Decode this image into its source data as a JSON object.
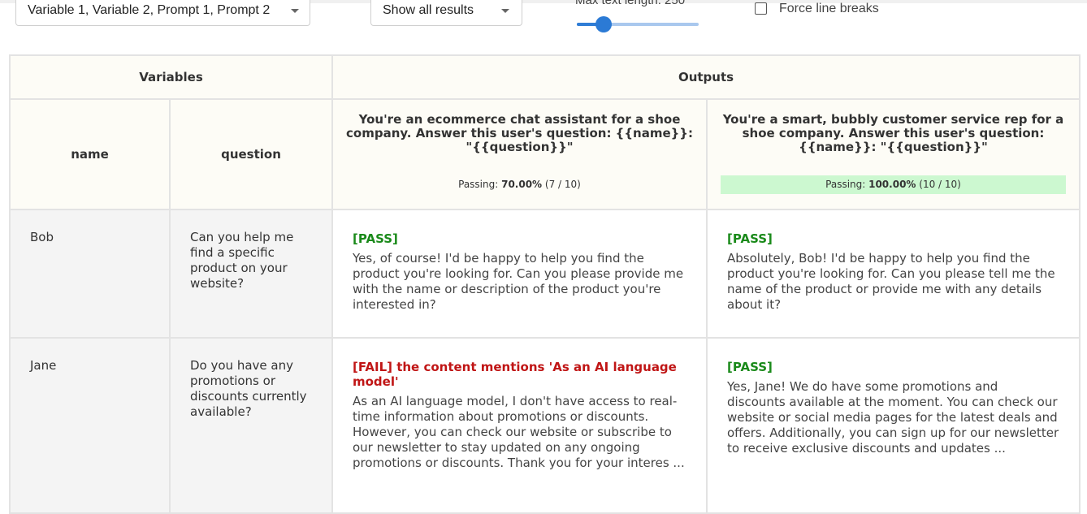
{
  "toolbar": {
    "columns_select": "Variable 1, Variable 2, Prompt 1, Prompt 2",
    "filter_select": "Show all results",
    "max_text_length_label": "Max text length: 250",
    "max_text_length_value": 250,
    "max_text_length_fraction": 0.22,
    "force_line_breaks_label": "Force line breaks",
    "force_line_breaks_checked": false
  },
  "table": {
    "variables_header": "Variables",
    "outputs_header": "Outputs",
    "var_columns": [
      "name",
      "question"
    ],
    "prompts": [
      {
        "text": "You're an ecommerce chat assistant for a shoe company. Answer this user's question: {{name}}: \"{{question}}\"",
        "passing_label": "Passing: ",
        "passing_percent": "70.00%",
        "passing_count": "(7 / 10)"
      },
      {
        "text": "You're a smart, bubbly customer service rep for a shoe company. Answer this user's question: {{name}}: \"{{question}}\"",
        "passing_label": "Passing: ",
        "passing_percent": "100.00%",
        "passing_count": "(10 / 10)"
      }
    ],
    "rows": [
      {
        "name": "Bob",
        "question": "Can you help me find a specific product on your website?",
        "outputs": [
          {
            "status": "[PASS]",
            "text": "Yes, of course! I'd be happy to help you find the product you're looking for. Can you please provide me with the name or description of the product you're interested in?"
          },
          {
            "status": "[PASS]",
            "text": "Absolutely, Bob! I'd be happy to help you find the product you're looking for. Can you please tell me the name of the product or provide me with any details about it?"
          }
        ]
      },
      {
        "name": "Jane",
        "question": "Do you have any promotions or discounts currently available?",
        "outputs": [
          {
            "status": "[FAIL] the content mentions 'As an AI language model'",
            "text": "As an AI language model, I don't have access to real-time information about promotions or discounts. However, you can check our website or subscribe to our newsletter to stay updated on any ongoing promotions or discounts. Thank you for your interes ..."
          },
          {
            "status": "[PASS]",
            "text": "Yes, Jane! We do have some promotions and discounts available at the moment. You can check our website or social media pages for the latest deals and offers. Additionally, you can sign up for our newsletter to receive exclusive discounts and updates ..."
          }
        ]
      }
    ]
  },
  "colors": {
    "pass": "#1a8a1a",
    "fail": "#c01515",
    "full_pass_bg": "#ccf8d0",
    "slider_accent": "#2b7ad5"
  }
}
